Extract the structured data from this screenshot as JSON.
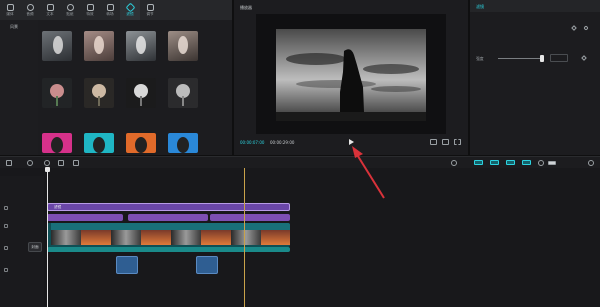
{
  "colors": {
    "accent": "#2cd3e0",
    "purple": "#7d4fb3",
    "teal": "#1a8a8a",
    "audio": "#3b6a9f",
    "arrow": "#d9323a",
    "playhead": "#e6e6e6",
    "marker": "#c9a24a"
  },
  "topbar": {
    "tabs": [
      {
        "label": "媒体",
        "icon": "media-icon"
      },
      {
        "label": "音频",
        "icon": "audio-icon"
      },
      {
        "label": "文本",
        "icon": "text-icon"
      },
      {
        "label": "贴纸",
        "icon": "sticker-icon"
      },
      {
        "label": "特效",
        "icon": "effects-icon"
      },
      {
        "label": "转场",
        "icon": "transition-icon"
      },
      {
        "label": "滤镜",
        "icon": "filter-icon"
      },
      {
        "label": "调节",
        "icon": "adjust-icon"
      }
    ]
  },
  "sidebar": {
    "items": [
      "风景",
      "",
      "",
      "",
      "",
      "",
      "",
      "",
      ""
    ]
  },
  "grid": {
    "section1": "",
    "section2": "",
    "captions": [
      "",
      "",
      "",
      "",
      "",
      "",
      "",
      ""
    ]
  },
  "player": {
    "title": "播放器",
    "timecode": "00:00:07:00",
    "duration": "00:00:29:00",
    "ratio": "",
    "play_icon": "play-icon"
  },
  "right": {
    "title": "滤镜",
    "subtitle": "",
    "intensity_label": "强度",
    "intensity_value": "",
    "name_label": ""
  },
  "timeline": {
    "ticks": [
      "",
      "",
      "",
      "",
      ""
    ],
    "cover_label": "封面",
    "clips": {
      "filter_track": "滤镜",
      "effect_a": "",
      "effect_b": "",
      "effect_c": "",
      "video": "",
      "audio_a": "",
      "audio_b": ""
    }
  }
}
